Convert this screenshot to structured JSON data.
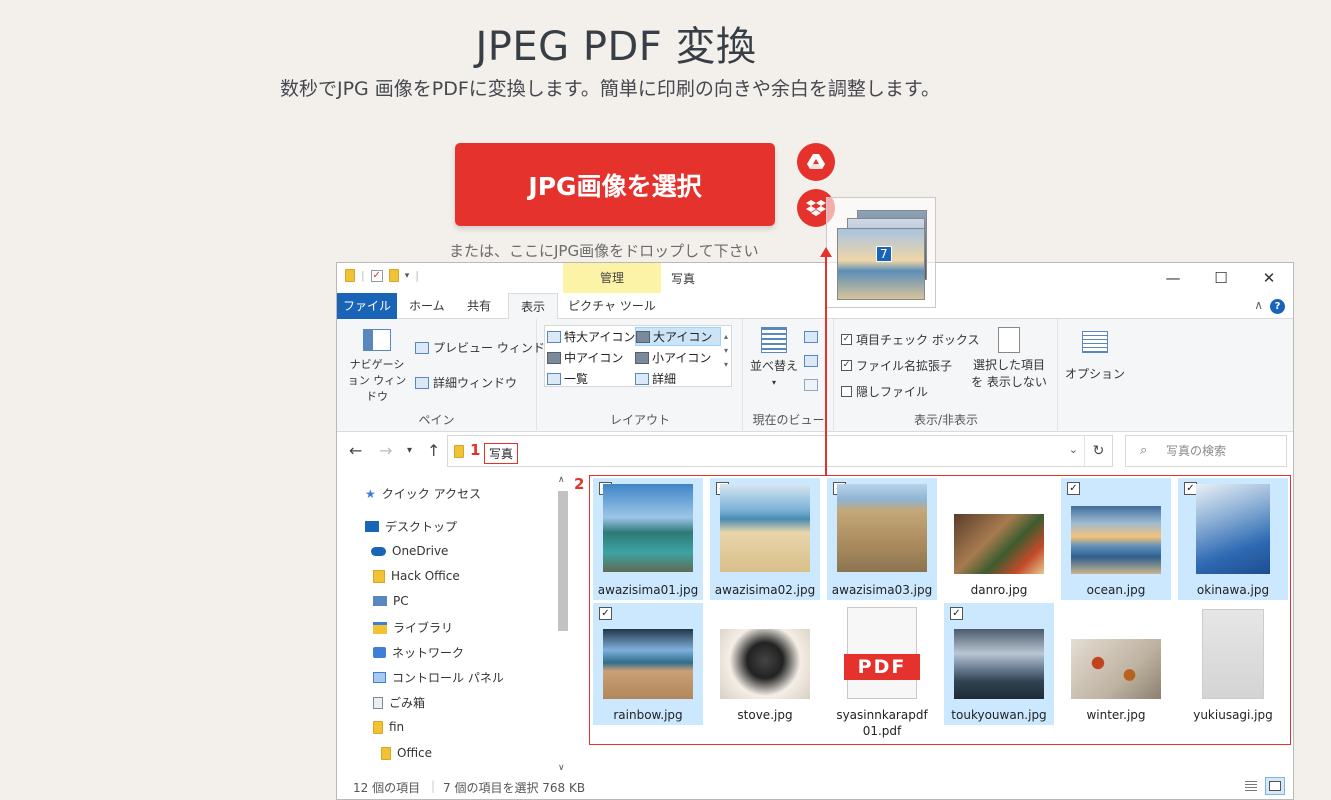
{
  "page": {
    "title": "JPEG PDF 変換",
    "subtitle": "数秒でJPG 画像をPDFに変換します。簡単に印刷の向きや余白を調整します。",
    "select_button": "JPG画像を選択",
    "drop_hint": "または、ここにJPG画像をドロップして下さい",
    "drag_count": "7",
    "accent_color": "#e5322d"
  },
  "explorer": {
    "context_tab": "管理",
    "window_title": "写真",
    "controls": [
      "—",
      "☐",
      "✕"
    ],
    "tabs": [
      "ファイル",
      "ホーム",
      "共有",
      "表示",
      "ピクチャ ツール"
    ],
    "ribbon": {
      "pane": {
        "label": "ペイン",
        "nav_pane": "ナビゲーション ウィンドウ",
        "preview_pane": "プレビュー ウィンドウ",
        "details_pane": "詳細ウィンドウ"
      },
      "layout": {
        "label": "レイアウト",
        "items": [
          "特大アイコン",
          "大アイコン",
          "中アイコン",
          "小アイコン",
          "一覧",
          "詳細"
        ],
        "selected": "大アイコン"
      },
      "current_view": {
        "label": "現在のビュー",
        "sort": "並べ替え"
      },
      "show_hide": {
        "label": "表示/非表示",
        "item_checkbox": "項目チェック ボックス",
        "file_ext": "ファイル名拡張子",
        "hidden_files": "隠しファイル",
        "hide_selected": "選択した項目を 表示しない",
        "item_checkbox_checked": true,
        "file_ext_checked": true,
        "hidden_files_checked": false
      },
      "options": "オプション"
    },
    "address": {
      "path": "写真",
      "marker": "1",
      "search_placeholder": "写真の検索"
    },
    "content_marker": "2",
    "sidebar": [
      "クイック アクセス",
      "デスクトップ",
      "OneDrive",
      "Hack Office",
      "PC",
      "ライブラリ",
      "ネットワーク",
      "コントロール パネル",
      "ごみ箱",
      "fin",
      "Office"
    ],
    "files": [
      {
        "name": "awazisima01.jpg",
        "selected": true
      },
      {
        "name": "awazisima02.jpg",
        "selected": true
      },
      {
        "name": "awazisima03.jpg",
        "selected": true
      },
      {
        "name": "danro.jpg",
        "selected": false
      },
      {
        "name": "ocean.jpg",
        "selected": true
      },
      {
        "name": "okinawa.jpg",
        "selected": true
      },
      {
        "name": "rainbow.jpg",
        "selected": true
      },
      {
        "name": "stove.jpg",
        "selected": false
      },
      {
        "name": "syasinnkarapdf01.pdf",
        "selected": false
      },
      {
        "name": "toukyouwan.jpg",
        "selected": true
      },
      {
        "name": "winter.jpg",
        "selected": false
      },
      {
        "name": "yukiusagi.jpg",
        "selected": false
      }
    ],
    "pdf_badge": "PDF",
    "status": {
      "count": "12 個の項目",
      "selection": "7 個の項目を選択 768 KB"
    }
  }
}
